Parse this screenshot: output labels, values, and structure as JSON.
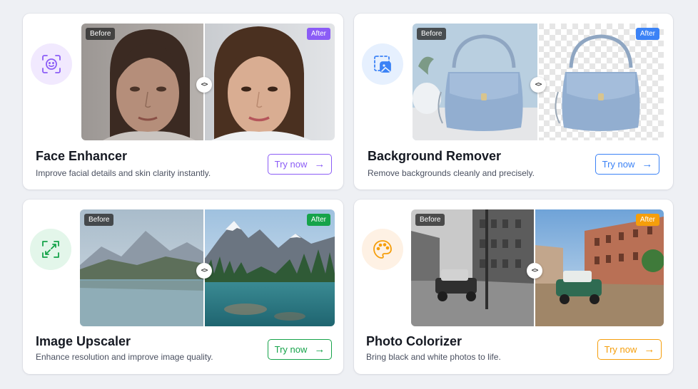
{
  "labels": {
    "before": "Before",
    "after": "After",
    "handle": "<>"
  },
  "cards": [
    {
      "title": "Face Enhancer",
      "description": "Improve facial details and skin clarity instantly.",
      "button": "Try now",
      "arrow": "→",
      "accent": "#8b5cf6",
      "icon_bg": "#f1e9fe",
      "icon": "face-scan-icon"
    },
    {
      "title": "Background Remover",
      "description": "Remove backgrounds cleanly and precisely.",
      "button": "Try now",
      "arrow": "→",
      "accent": "#3b82f6",
      "icon_bg": "#e6f0fe",
      "icon": "cutout-icon"
    },
    {
      "title": "Image Upscaler",
      "description": "Enhance resolution and improve image quality.",
      "button": "Try now",
      "arrow": "→",
      "accent": "#16a34a",
      "icon_bg": "#e3f6ea",
      "icon": "expand-icon"
    },
    {
      "title": "Photo Colorizer",
      "description": "Bring black and white photos to life.",
      "button": "Try now",
      "arrow": "→",
      "accent": "#f59e0b",
      "icon_bg": "#fef1e4",
      "icon": "palette-icon"
    }
  ]
}
